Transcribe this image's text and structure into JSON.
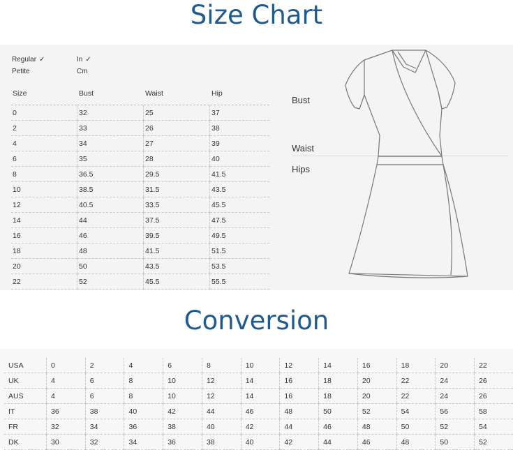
{
  "size_chart": {
    "title": "Size Chart",
    "options": {
      "fit": [
        {
          "label": "Regular",
          "selected": true
        },
        {
          "label": "Petite",
          "selected": false
        }
      ],
      "unit": [
        {
          "label": "In",
          "selected": true
        },
        {
          "label": "Cm",
          "selected": false
        }
      ],
      "check_glyph": "✓"
    },
    "columns": [
      "Size",
      "Bust",
      "Waist",
      "Hip"
    ],
    "rows": [
      [
        "0",
        "32",
        "25",
        "37"
      ],
      [
        "2",
        "33",
        "26",
        "38"
      ],
      [
        "4",
        "34",
        "27",
        "39"
      ],
      [
        "6",
        "35",
        "28",
        "40"
      ],
      [
        "8",
        "36.5",
        "29.5",
        "41.5"
      ],
      [
        "10",
        "38.5",
        "31.5",
        "43.5"
      ],
      [
        "12",
        "40.5",
        "33.5",
        "45.5"
      ],
      [
        "14",
        "44",
        "37.5",
        "47.5"
      ],
      [
        "16",
        "46",
        "39.5",
        "49.5"
      ],
      [
        "18",
        "48",
        "41.5",
        "51.5"
      ],
      [
        "20",
        "50",
        "43.5",
        "53.5"
      ],
      [
        "22",
        "52",
        "45.5",
        "55.5"
      ]
    ],
    "measure_labels": {
      "bust": "Bust",
      "waist": "Waist",
      "hips": "Hips"
    }
  },
  "conversion": {
    "title": "Conversion",
    "rows": [
      {
        "label": "USA",
        "values": [
          "0",
          "2",
          "4",
          "6",
          "8",
          "10",
          "12",
          "14",
          "16",
          "18",
          "20",
          "22"
        ]
      },
      {
        "label": "UK",
        "values": [
          "4",
          "6",
          "8",
          "10",
          "12",
          "14",
          "16",
          "18",
          "20",
          "22",
          "24",
          "26"
        ]
      },
      {
        "label": "AUS",
        "values": [
          "4",
          "6",
          "8",
          "10",
          "12",
          "14",
          "16",
          "18",
          "20",
          "22",
          "24",
          "26"
        ]
      },
      {
        "label": "IT",
        "values": [
          "36",
          "38",
          "40",
          "42",
          "44",
          "46",
          "48",
          "50",
          "52",
          "54",
          "56",
          "58"
        ]
      },
      {
        "label": "FR",
        "values": [
          "32",
          "34",
          "36",
          "38",
          "40",
          "42",
          "44",
          "46",
          "48",
          "50",
          "52",
          "54"
        ]
      },
      {
        "label": "DK",
        "values": [
          "30",
          "32",
          "34",
          "36",
          "38",
          "40",
          "42",
          "44",
          "46",
          "48",
          "50",
          "52"
        ]
      }
    ]
  },
  "colors": {
    "title": "#1f5b8e",
    "panel": "#f4f4f4",
    "text": "#333333"
  }
}
